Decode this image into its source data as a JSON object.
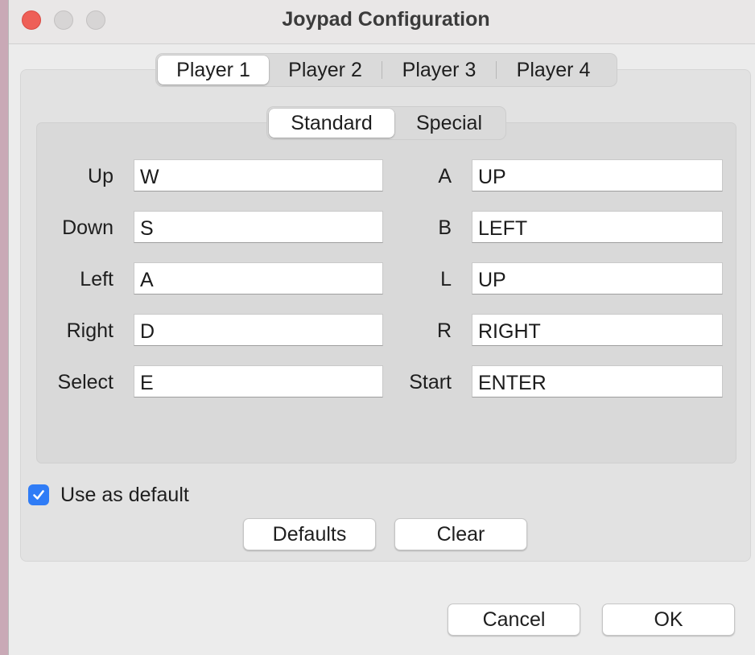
{
  "window": {
    "title": "Joypad Configuration"
  },
  "players": {
    "tabs": [
      "Player 1",
      "Player 2",
      "Player 3",
      "Player 4"
    ],
    "selected": "Player 1"
  },
  "modes": {
    "tabs": [
      "Standard",
      "Special"
    ],
    "selected": "Standard"
  },
  "bindings": {
    "left": [
      {
        "label": "Up",
        "value": "W"
      },
      {
        "label": "Down",
        "value": "S"
      },
      {
        "label": "Left",
        "value": "A"
      },
      {
        "label": "Right",
        "value": "D"
      },
      {
        "label": "Select",
        "value": "E"
      }
    ],
    "right": [
      {
        "label": "A",
        "value": "UP"
      },
      {
        "label": "B",
        "value": "LEFT"
      },
      {
        "label": "L",
        "value": "UP"
      },
      {
        "label": "R",
        "value": "RIGHT"
      },
      {
        "label": "Start",
        "value": "ENTER"
      }
    ]
  },
  "use_default": {
    "label": "Use as default",
    "checked": true
  },
  "buttons": {
    "defaults": "Defaults",
    "clear": "Clear",
    "cancel": "Cancel",
    "ok": "OK"
  },
  "colors": {
    "checkbox": "#2f7cf6",
    "close": "#ee5f57"
  }
}
